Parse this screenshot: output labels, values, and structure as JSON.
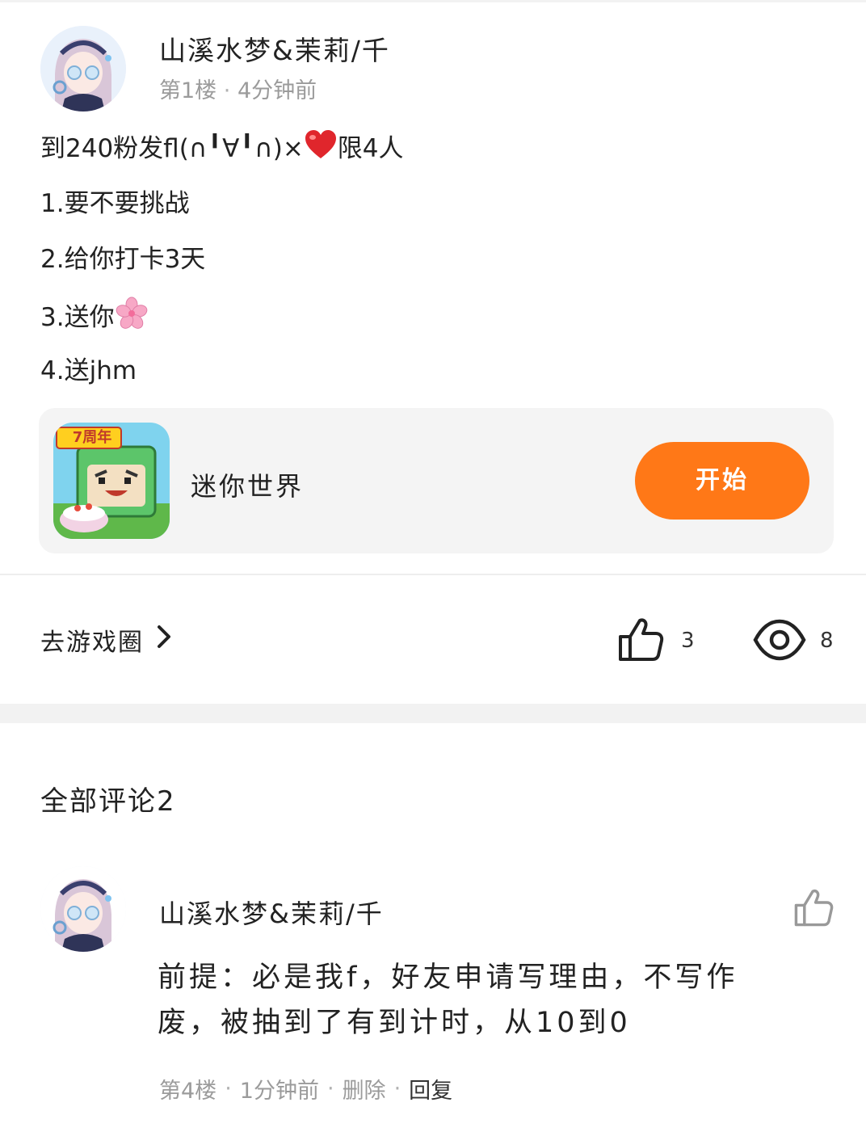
{
  "post": {
    "author": "山溪水梦&茉莉/千",
    "floor": "第1楼",
    "time": "4分钟前",
    "lines": {
      "line1_prefix": "到240粉发fl(∩╹∀╹∩)",
      "line1_x": "×",
      "line1_suffix": "限4人",
      "line2": "1.要不要挑战",
      "line3": "2.给你打卡3天",
      "line4": "3.送你",
      "line5": "4.送jhm"
    },
    "emoji": {
      "heart": "heart-emoji",
      "blossom": "cherry-blossom-emoji"
    }
  },
  "game_card": {
    "name": "迷你世界",
    "start_label": "开始",
    "icon_badge": "7周年",
    "accent": "#ff7817"
  },
  "actions": {
    "goto_circle": "去游戏圈",
    "like_count": "3",
    "view_count": "8"
  },
  "comments": {
    "title": "全部评论2",
    "items": [
      {
        "author": "山溪水梦&茉莉/千",
        "text": "前提：必是我f，好友申请写理由，不写作废，被抽到了有到计时，从10到0",
        "floor": "第4楼",
        "time": "1分钟前",
        "delete_label": "删除",
        "reply_label": "回复"
      }
    ]
  }
}
